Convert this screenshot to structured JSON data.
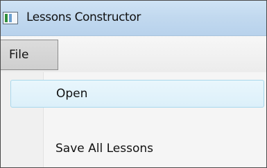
{
  "window": {
    "title": "Lessons Constructor",
    "icon": "app-icon"
  },
  "menubar": {
    "items": [
      {
        "label": "File",
        "state": "open"
      }
    ]
  },
  "file_menu": {
    "items": [
      {
        "label": "Open",
        "highlighted": true
      },
      {
        "label": "Save All Lessons",
        "highlighted": false
      }
    ]
  },
  "colors": {
    "titlebar": "#c2d9ef",
    "highlight_border": "#a8d8ec",
    "highlight_fill": "#e2f3fb"
  }
}
